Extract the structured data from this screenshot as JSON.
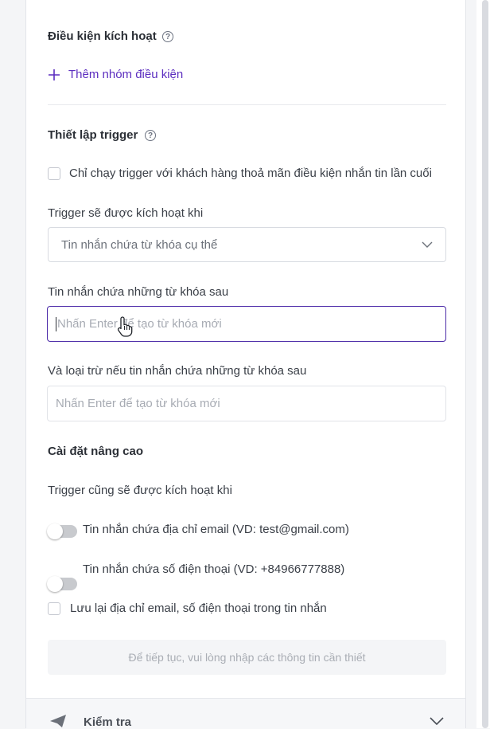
{
  "conditions": {
    "title": "Điều kiện kích hoạt",
    "add_group_label": "Thêm nhóm điều kiện"
  },
  "trigger": {
    "title": "Thiết lập trigger",
    "last_message_checkbox_label": "Chỉ chạy trigger với khách hàng thoả mãn điều kiện nhắn tin lần cuối",
    "activate_when_label": "Trigger sẽ được kích hoạt khi",
    "activate_when_value": "Tin nhắn chứa từ khóa cụ thể",
    "keywords_label": "Tin nhắn chứa những từ khóa sau",
    "keywords_placeholder": "Nhấn Enter để tạo từ khóa mới",
    "exclude_label": "Và loại trừ nếu tin nhắn chứa những từ khóa sau",
    "exclude_placeholder": "Nhấn Enter để tạo từ khóa mới"
  },
  "advanced": {
    "title": "Cài đặt nâng cao",
    "also_activate_label": "Trigger cũng sẽ được kích hoạt khi",
    "email_toggle_label": "Tin nhắn chứa địa chỉ email (VD: test@gmail.com)",
    "email_toggle_on": false,
    "phone_toggle_label": "Tin nhắn chứa số điện thoại (VD: +84966777888)",
    "phone_toggle_on": false,
    "save_contact_label": "Lưu lại địa chỉ email, số điện thoại trong tin nhắn",
    "continue_button_label": "Để tiếp tục, vui lòng nhập các thông tin cần thiết"
  },
  "test_section": {
    "title": "Kiểm tra"
  },
  "colors": {
    "accent": "#5b2dbf",
    "focus_border": "#4b2aa8"
  }
}
